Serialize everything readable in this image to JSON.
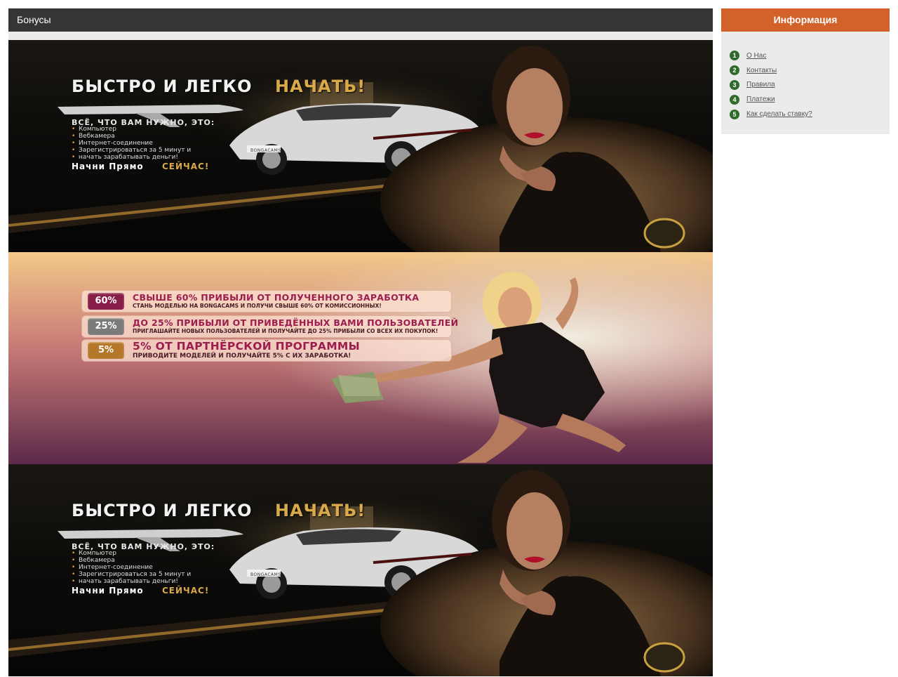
{
  "main": {
    "title": "Бонусы"
  },
  "banner_a": {
    "title": "БЫСТРО И ЛЕГКО",
    "title_accent": "НАЧАТЬ!",
    "subtitle": "ВСЁ, ЧТО ВАМ НУЖНО, ЭТО:",
    "items": [
      "Компьютер",
      "Вебкамера",
      "Интернет-соединение",
      "Зарегистрироваться за 5 минут и",
      "начать зарабатывать деньги!"
    ],
    "cta": "Начни Прямо",
    "cta_accent": "СЕЙЧАС!",
    "plate": "BONGACAMS"
  },
  "banner_b": {
    "offers": [
      {
        "badge": "60%",
        "color": "#8a1e4a",
        "headline": "СВЫШЕ 60% ПРИБЫЛИ ОТ ПОЛУЧЕННОГО ЗАРАБОТКА",
        "sub": "СТАНЬ МОДЕЛЬЮ НА BONGACAMS И ПОЛУЧИ СВЫШЕ 60% ОТ КОМИССИОННЫХ!"
      },
      {
        "badge": "25%",
        "color": "#7a7a7a",
        "headline": "ДО 25% ПРИБЫЛИ ОТ ПРИВЕДЁННЫХ ВАМИ ПОЛЬЗОВАТЕЛЕЙ",
        "sub": "ПРИГЛАШАЙТЕ НОВЫХ ПОЛЬЗОВАТЕЛЕЙ И ПОЛУЧАЙТЕ ДО 25% ПРИБЫЛИ СО ВСЕХ ИХ ПОКУПОК!"
      },
      {
        "badge": "5%",
        "color": "#b5782a",
        "headline": "5% ОТ ПАРТНЁРСКОЙ ПРОГРАММЫ",
        "sub": "ПРИВОДИТЕ МОДЕЛЕЙ И ПОЛУЧАЙТЕ 5% С ИХ ЗАРАБОТКА!"
      }
    ]
  },
  "sidebar": {
    "title": "Информация",
    "items": [
      {
        "num": "1",
        "label": "О Нас"
      },
      {
        "num": "2",
        "label": "Контакты"
      },
      {
        "num": "3",
        "label": "Правила"
      },
      {
        "num": "4",
        "label": "Платежи"
      },
      {
        "num": "5",
        "label": "Как сделать ставку?"
      }
    ]
  },
  "colors": {
    "header_dark": "#353535",
    "sidebar_accent": "#d2622a",
    "number_badge": "#2f6b2a"
  }
}
